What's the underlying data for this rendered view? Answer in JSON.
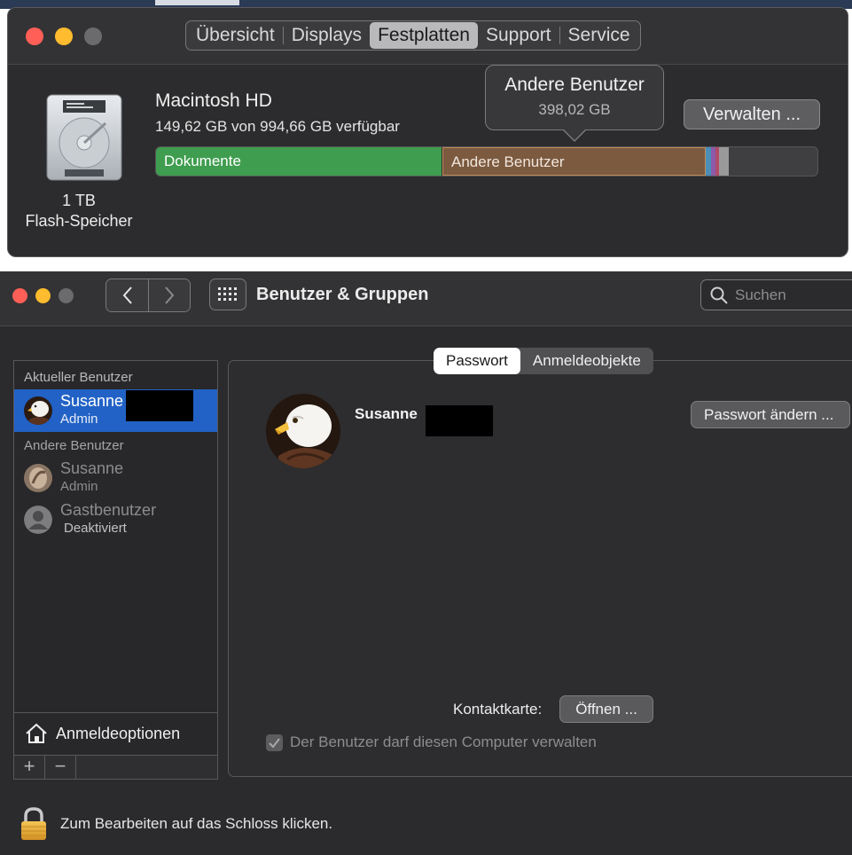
{
  "about_window": {
    "tabs": [
      {
        "label": "Übersicht",
        "active": false
      },
      {
        "label": "Displays",
        "active": false
      },
      {
        "label": "Festplatten",
        "active": true
      },
      {
        "label": "Support",
        "active": false
      },
      {
        "label": "Service",
        "active": false
      }
    ],
    "disk": {
      "capacity": "1 TB",
      "type": "Flash-Speicher",
      "volume_name": "Macintosh HD",
      "available_text": "149,62 GB von 994,66 GB verfügbar",
      "manage_button": "Verwalten ...",
      "bar": {
        "documents_label": "Dokumente",
        "other_users_label": "Andere Benutzer",
        "colors": {
          "documents": "#3f9d4f",
          "other_users": "#7b5a40",
          "small_1": "#4a8fb8",
          "small_2": "#8c5aa8",
          "small_3": "#b04a6a",
          "small_4": "#9a9a9a"
        }
      },
      "tooltip": {
        "title": "Andere Benutzer",
        "value": "398,02 GB"
      }
    }
  },
  "users_window": {
    "title": "Benutzer & Gruppen",
    "search_placeholder": "Suchen",
    "sidebar": {
      "current_header": "Aktueller Benutzer",
      "current_user": {
        "name": "Susanne",
        "role": "Admin"
      },
      "other_header": "Andere Benutzer",
      "other_users": [
        {
          "name": "Susanne",
          "role": "Admin"
        },
        {
          "name": "Gastbenutzer",
          "role": "Deaktiviert"
        }
      ],
      "login_options": "Anmeldeoptionen",
      "add": "+",
      "remove": "−"
    },
    "tabs": [
      {
        "label": "Passwort",
        "active": true
      },
      {
        "label": "Anmeldeobjekte",
        "active": false
      }
    ],
    "detail": {
      "user_name": "Susanne",
      "change_password_button": "Passwort ändern ...",
      "contact_card_label": "Kontaktkarte:",
      "open_button": "Öffnen ...",
      "admin_checkbox_label": "Der Benutzer darf diesen Computer verwalten",
      "admin_checked": true
    },
    "lock_text": "Zum Bearbeiten auf das Schloss klicken."
  }
}
